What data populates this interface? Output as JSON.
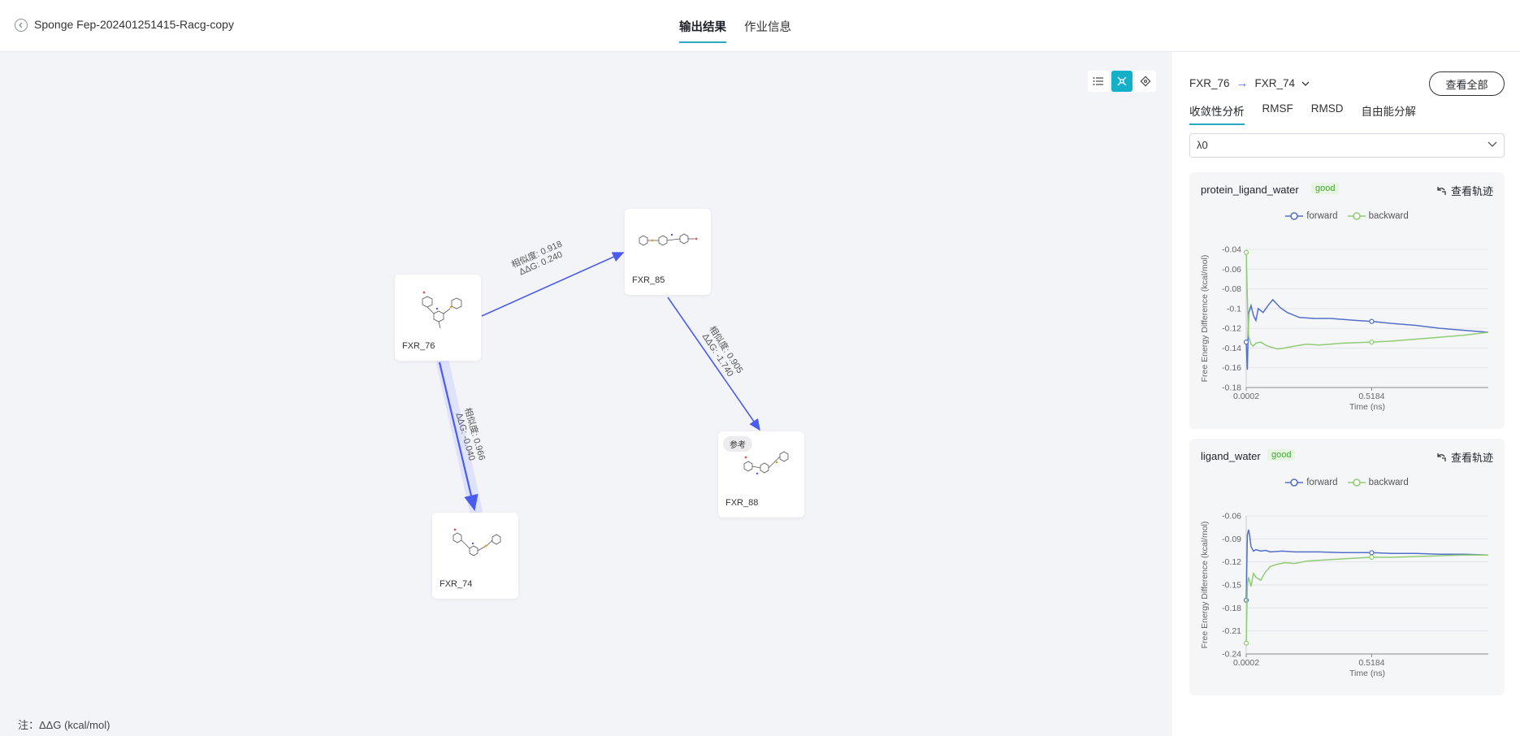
{
  "header": {
    "title": "Sponge Fep-202401251415-Racg-copy",
    "tabs": [
      {
        "label": "输出结果",
        "active": true
      },
      {
        "label": "作业信息",
        "active": false
      }
    ]
  },
  "canvas": {
    "nodes": [
      {
        "id": "FXR_76",
        "label": "FXR_76"
      },
      {
        "id": "FXR_85",
        "label": "FXR_85"
      },
      {
        "id": "FXR_88",
        "label": "FXR_88",
        "badge": "参考"
      },
      {
        "id": "FXR_74",
        "label": "FXR_74"
      }
    ],
    "edges": [
      {
        "from": "FXR_76",
        "to": "FXR_85",
        "similarity": "相似度: 0.918",
        "ddg": "ΔΔG: 0.240"
      },
      {
        "from": "FXR_85",
        "to": "FXR_88",
        "similarity": "相似度: 0.905",
        "ddg": "ΔΔG: -1.740"
      },
      {
        "from": "FXR_76",
        "to": "FXR_74",
        "similarity": "相似度: 0.966",
        "ddg": "ΔΔG: -0.040",
        "highlighted": true
      }
    ],
    "note": "注：ΔΔG (kcal/mol)",
    "edge_color": "#4a5cf0"
  },
  "panel": {
    "pair_from": "FXR_76",
    "pair_to": "FXR_74",
    "view_all": "查看全部",
    "tabs": [
      "收敛性分析",
      "RMSF",
      "RMSD",
      "自由能分解"
    ],
    "active_tab": 0,
    "lambda_value": "λ0",
    "cards": [
      {
        "title": "protein_ligand_water",
        "status": "good",
        "trajectory": "查看轨迹",
        "chart_data": {
          "type": "line",
          "xlabel": "Time (ns)",
          "ylabel": "Free Energy Difference (kcal/mol)",
          "x_ticks": [
            "0.0002",
            "0.5184"
          ],
          "y_ticks": [
            "-0.04",
            "-0.06",
            "-0.08",
            "-0.1",
            "-0.12",
            "-0.14",
            "-0.16",
            "-0.18"
          ],
          "ylim": [
            -0.18,
            -0.04
          ],
          "xlim": [
            0.0002,
            1.0
          ],
          "series": [
            {
              "name": "forward",
              "color": "#5470c6",
              "x": [
                0.0002,
                0.005,
                0.01,
                0.02,
                0.03,
                0.04,
                0.05,
                0.07,
                0.09,
                0.11,
                0.14,
                0.17,
                0.22,
                0.28,
                0.35,
                0.45,
                0.5184,
                0.6,
                0.7,
                0.8,
                0.9,
                1.0
              ],
              "y": [
                -0.134,
                -0.162,
                -0.105,
                -0.097,
                -0.107,
                -0.112,
                -0.1,
                -0.104,
                -0.097,
                -0.091,
                -0.099,
                -0.104,
                -0.109,
                -0.11,
                -0.11,
                -0.112,
                -0.113,
                -0.115,
                -0.117,
                -0.12,
                -0.122,
                -0.124
              ]
            },
            {
              "name": "backward",
              "color": "#91cc75",
              "x": [
                0.0002,
                0.005,
                0.01,
                0.02,
                0.03,
                0.04,
                0.06,
                0.08,
                0.1,
                0.13,
                0.16,
                0.2,
                0.25,
                0.3,
                0.4,
                0.5184,
                0.6,
                0.7,
                0.8,
                0.9,
                1.0
              ],
              "y": [
                -0.043,
                -0.09,
                -0.128,
                -0.136,
                -0.138,
                -0.135,
                -0.134,
                -0.137,
                -0.139,
                -0.141,
                -0.14,
                -0.138,
                -0.136,
                -0.137,
                -0.135,
                -0.134,
                -0.133,
                -0.131,
                -0.129,
                -0.127,
                -0.124
              ]
            }
          ]
        }
      },
      {
        "title": "ligand_water",
        "status": "good",
        "trajectory": "查看轨迹",
        "chart_data": {
          "type": "line",
          "xlabel": "Time (ns)",
          "ylabel": "Free Energy Difference (kcal/mol)",
          "x_ticks": [
            "0.0002",
            "0.5184"
          ],
          "y_ticks": [
            "-0.06",
            "-0.09",
            "-0.12",
            "-0.15",
            "-0.18",
            "-0.21",
            "-0.24"
          ],
          "ylim": [
            -0.24,
            -0.06
          ],
          "xlim": [
            0.0002,
            1.0
          ],
          "series": [
            {
              "name": "forward",
              "color": "#5470c6",
              "x": [
                0.0002,
                0.005,
                0.01,
                0.015,
                0.02,
                0.03,
                0.04,
                0.06,
                0.08,
                0.1,
                0.15,
                0.2,
                0.3,
                0.4,
                0.5184,
                0.6,
                0.7,
                0.8,
                0.9,
                1.0
              ],
              "y": [
                -0.17,
                -0.085,
                -0.078,
                -0.087,
                -0.1,
                -0.106,
                -0.104,
                -0.106,
                -0.105,
                -0.107,
                -0.106,
                -0.107,
                -0.107,
                -0.108,
                -0.108,
                -0.109,
                -0.109,
                -0.11,
                -0.11,
                -0.111
              ]
            },
            {
              "name": "backward",
              "color": "#91cc75",
              "x": [
                0.0002,
                0.005,
                0.01,
                0.02,
                0.03,
                0.04,
                0.06,
                0.08,
                0.1,
                0.13,
                0.16,
                0.2,
                0.25,
                0.3,
                0.4,
                0.5184,
                0.6,
                0.7,
                0.8,
                0.9,
                1.0
              ],
              "y": [
                -0.226,
                -0.15,
                -0.14,
                -0.152,
                -0.135,
                -0.14,
                -0.144,
                -0.133,
                -0.126,
                -0.123,
                -0.121,
                -0.122,
                -0.119,
                -0.118,
                -0.116,
                -0.114,
                -0.114,
                -0.113,
                -0.112,
                -0.111,
                -0.111
              ]
            }
          ]
        }
      }
    ]
  }
}
